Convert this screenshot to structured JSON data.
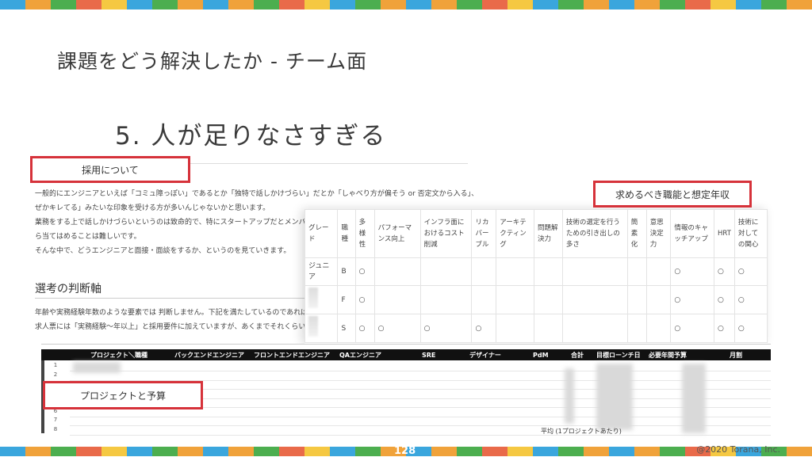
{
  "slide": {
    "title": "課題をどう解決したか - チーム面",
    "subtitle": "5. 人が足りなさすぎる",
    "page_number": "128",
    "copyright": "@2020 Torana, Inc."
  },
  "stripe_colors": [
    "#3aa6dd",
    "#f0a23a",
    "#4cae4f",
    "#e96a4a",
    "#f5c842",
    "#3aa6dd",
    "#4cae4f",
    "#f0a23a"
  ],
  "annotations": {
    "recruit": "採用について",
    "skills": "求めるべき職能と想定年収",
    "project": "プロジェクトと予算"
  },
  "doc": {
    "lines": [
      "一般的にエンジニアといえば「コミュ障っぽい」であるとか「独特で話しかけづらい」だとか「しゃべり方が偏そう or 否定文から入る」、「な",
      "ぜかキレてる」みたいな印象を受ける方が多いんじゃないかと思います。",
      "業務をする上で話しかけづらいというのは致命的で、特にスタートアップだとメンバー",
      "ら当てはめることは難しいです。",
      "",
      "そんな中で、どうエンジニアと面接・面談をするか、というのを見ていきます。"
    ],
    "heading": "選考の判断軸",
    "lines2": [
      "年齢や実務経験年数のような要素では 判断しません。下記を満たしているのであれば",
      "求人票には「実務経験〜年以上」と採用要件に加えていますが、あくまでそれくらいの"
    ]
  },
  "skill_table": {
    "headers": [
      "グレード",
      "職種",
      "多様性",
      "パフォーマンス向上",
      "インフラ面におけるコスト削減",
      "リカバーブル",
      "アーキテクティング",
      "問題解決力",
      "技術の選定を行うための引き出しの多さ",
      "簡素化",
      "意思決定力",
      "情報のキャッチアップ",
      "HRT",
      "技術に対しての関心"
    ],
    "rows": [
      [
        "ジュニア",
        "B",
        "○",
        "",
        "",
        "",
        "",
        "",
        "",
        "",
        "",
        "○",
        "○",
        "○"
      ],
      [
        "",
        "F",
        "○",
        "",
        "",
        "",
        "",
        "",
        "",
        "",
        "",
        "○",
        "○",
        "○"
      ],
      [
        "",
        "S",
        "○",
        "○",
        "○",
        "○",
        "",
        "",
        "",
        "",
        "",
        "○",
        "○",
        "○"
      ]
    ]
  },
  "sheet": {
    "headers": [
      "プロジェクト＼職種",
      "バックエンドエンジニア",
      "フロントエンドエンジニア",
      "QAエンジニア",
      "SRE",
      "デザイナー",
      "PdM",
      "合計",
      "目標ローンチ日",
      "必要年間予算",
      "月割"
    ],
    "row_numbers": [
      "1",
      "2",
      "3",
      "4",
      "5",
      "6",
      "7",
      "8"
    ],
    "footer_label": "平均 (1プロジェクトあたり)"
  }
}
